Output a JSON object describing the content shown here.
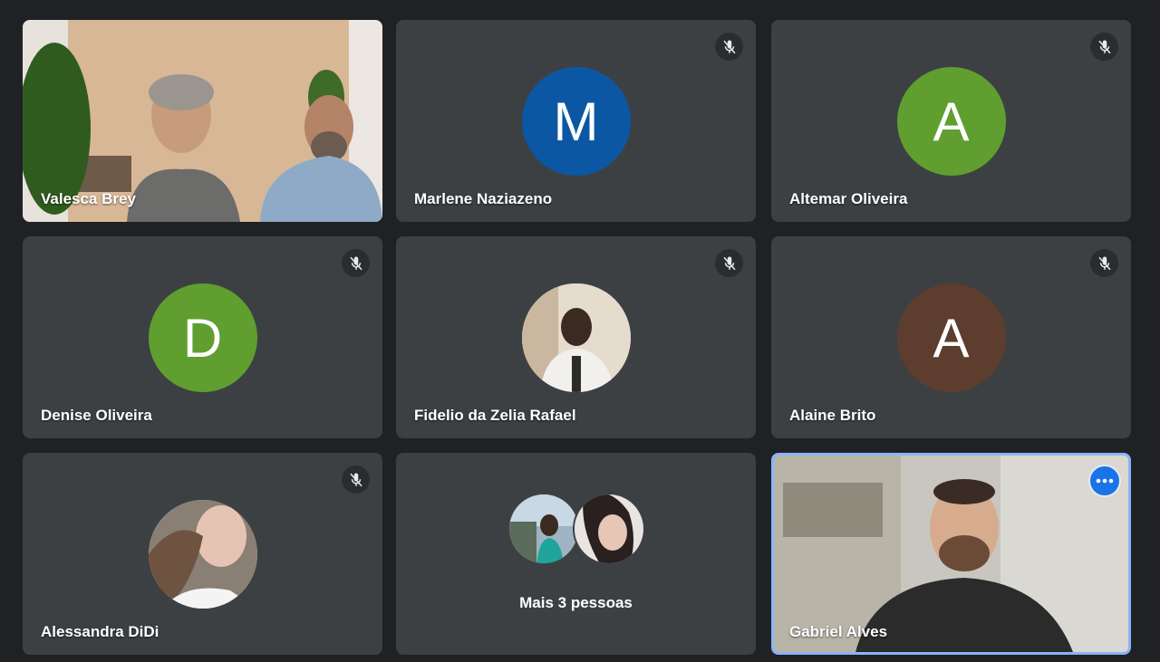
{
  "participants": [
    {
      "name": "Valesca Brey",
      "type": "video"
    },
    {
      "name": "Marlene Naziazeno",
      "initial": "M",
      "color": "#0b57a4",
      "muted": true
    },
    {
      "name": "Altemar Oliveira",
      "initial": "A",
      "color": "#5f9e2f",
      "muted": true
    },
    {
      "name": "Denise Oliveira",
      "initial": "D",
      "color": "#5f9e2f",
      "muted": true
    },
    {
      "name": "Fidelio da Zelia Rafael",
      "type": "photo",
      "muted": true
    },
    {
      "name": "Alaine Brito",
      "initial": "A",
      "color": "#5d3d2e",
      "muted": true
    },
    {
      "name": "Alessandra DiDi",
      "type": "photo",
      "muted": true
    },
    {
      "more_label": "Mais 3 pessoas"
    },
    {
      "name": "Gabriel Alves",
      "type": "video",
      "highlighted": true,
      "menu_icon": "more-horiz-icon"
    }
  ],
  "colors": {
    "background": "#202124",
    "tile": "#3c4043",
    "highlight_border": "#8ab4f8",
    "menu_button": "#1a73e8"
  }
}
